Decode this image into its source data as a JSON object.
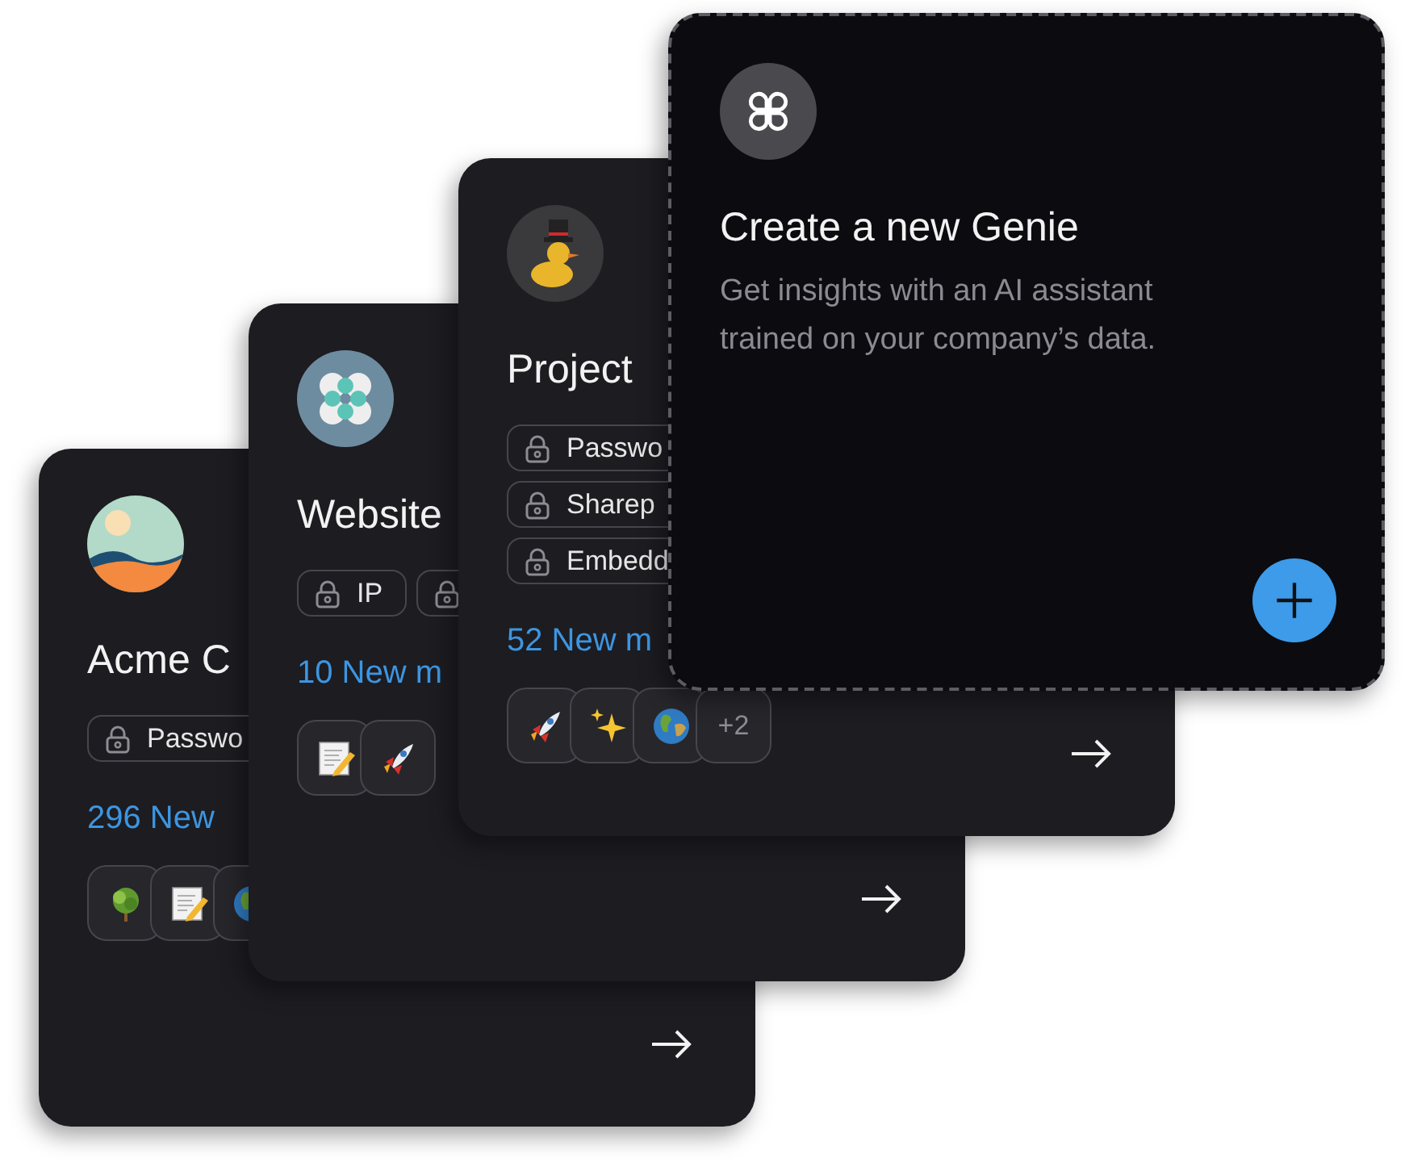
{
  "cards": [
    {
      "kind": "genie",
      "avatar": {
        "kind": "landscape"
      },
      "title": "Acme C",
      "tags": {
        "kind": "row",
        "items": [
          {
            "kind": "labeled",
            "label": "Passwo"
          }
        ]
      },
      "count": "296 New",
      "chips": [
        {
          "kind": "tree"
        },
        {
          "kind": "notepad"
        },
        {
          "kind": "globe"
        }
      ]
    },
    {
      "kind": "genie",
      "avatar": {
        "kind": "flower"
      },
      "title": "Website",
      "tags": {
        "kind": "row",
        "items": [
          {
            "kind": "labeled",
            "label": "IP"
          },
          {
            "kind": "icon-only"
          }
        ]
      },
      "count": "10 New m",
      "chips": [
        {
          "kind": "notepad"
        },
        {
          "kind": "rocket"
        }
      ]
    },
    {
      "kind": "genie",
      "avatar": {
        "kind": "duck"
      },
      "title": "Project",
      "tags": {
        "kind": "column",
        "items": [
          {
            "kind": "labeled",
            "label": "Passwo"
          },
          {
            "kind": "labeled",
            "label": "Sharep"
          },
          {
            "kind": "labeled",
            "label": "Embedd"
          }
        ]
      },
      "count": "52 New m",
      "chips": [
        {
          "kind": "rocket"
        },
        {
          "kind": "sparkles"
        },
        {
          "kind": "globe"
        },
        {
          "kind": "count",
          "label": "+2"
        }
      ]
    },
    {
      "kind": "create",
      "avatar": {
        "kind": "clover"
      },
      "title": "Create a new Genie",
      "description": "Get insights with an AI assistant trained on your company’s data."
    }
  ]
}
